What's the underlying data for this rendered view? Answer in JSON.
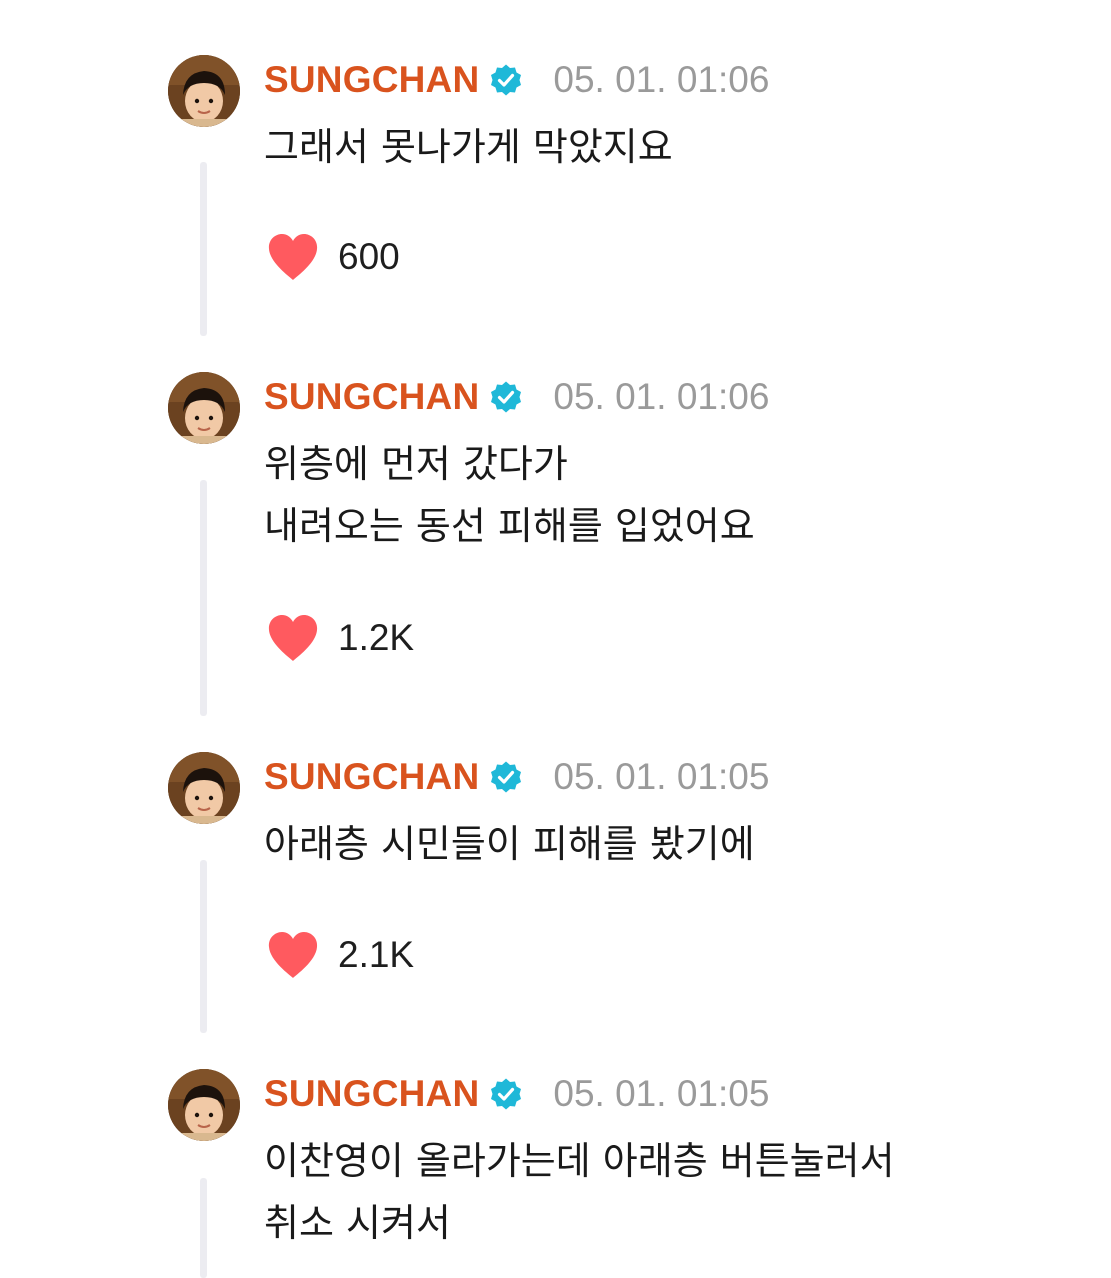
{
  "colors": {
    "author": "#d9531e",
    "verified_badge": "#1fb8d8",
    "timestamp": "#9a9a9a",
    "heart": "#ff5a5f",
    "thread_line": "#ececf1"
  },
  "posts": [
    {
      "author": "SUNGCHAN",
      "verified_icon": "verified-badge-icon",
      "timestamp": "05. 01. 01:06",
      "message": "그래서 못나가게 막았지요",
      "like_icon": "heart-icon",
      "likes": "600"
    },
    {
      "author": "SUNGCHAN",
      "verified_icon": "verified-badge-icon",
      "timestamp": "05. 01. 01:06",
      "message": "위층에 먼저 갔다가\n내려오는 동선 피해를 입었어요",
      "like_icon": "heart-icon",
      "likes": "1.2K"
    },
    {
      "author": "SUNGCHAN",
      "verified_icon": "verified-badge-icon",
      "timestamp": "05. 01. 01:05",
      "message": "아래층 시민들이 피해를 봤기에",
      "like_icon": "heart-icon",
      "likes": "2.1K"
    },
    {
      "author": "SUNGCHAN",
      "verified_icon": "verified-badge-icon",
      "timestamp": "05. 01. 01:05",
      "message": "이찬영이 올라가는데 아래층 버튼눌러서\n취소 시켜서",
      "like_icon": "heart-icon"
    }
  ]
}
